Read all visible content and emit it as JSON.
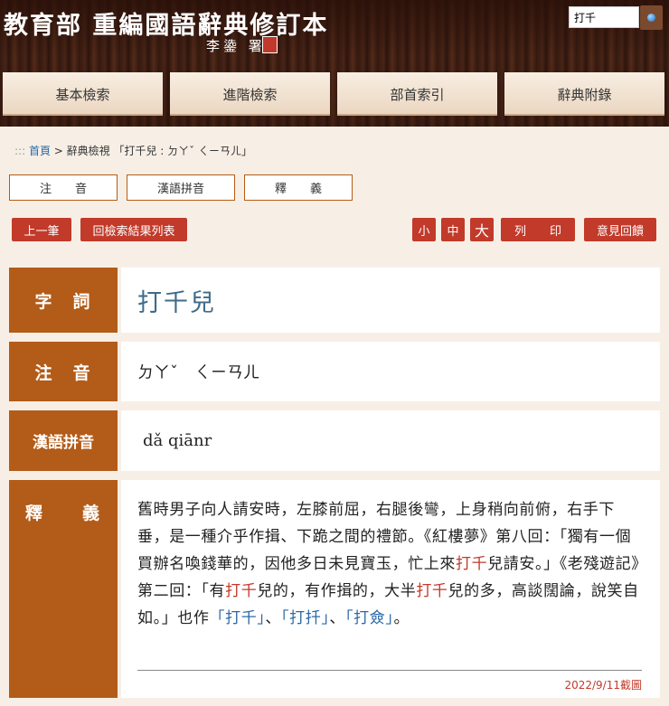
{
  "header": {
    "title": "教育部 重編國語辭典修訂本",
    "calligrapher": "李鍌 署",
    "search": {
      "value": "打千"
    }
  },
  "nav": [
    "基本檢索",
    "進階檢索",
    "部首索引",
    "辭典附錄"
  ],
  "breadcrumb": {
    "dots": ":::",
    "home": "首頁",
    "current": " > 辭典檢視 「打千兒 : ㄉㄚˇ ㄑㄧㄢㄦ」"
  },
  "view_tabs": [
    "注　　音",
    "漢語拼音",
    "釋　　義"
  ],
  "buttons": {
    "prev": "上一筆",
    "back": "回檢索結果列表",
    "small": "小",
    "medium": "中",
    "large": "大",
    "print": "列　　印",
    "feedback": "意見回饋"
  },
  "entry": {
    "labels": {
      "word": "字　詞",
      "zhuyin": "注　音",
      "pinyin": "漢語拼音",
      "definition": "釋　　義"
    },
    "word": "打千兒",
    "zhuyin": "ㄉㄚˇ　ㄑㄧㄢㄦ",
    "pinyin": "dǎ  qiānr",
    "definition": {
      "p1": "舊時男子向人請安時，左膝前屈，右腿後彎，上身稍向前俯，右手下垂，是一種介乎作揖、下跪之間的禮節。《紅樓夢》第八回：「獨有一個買辦名喚錢華的，因他多日未見寶玉，忙上來",
      "h1": "打千",
      "p2": "兒請安。」《老殘遊記》第二回：「有",
      "h2": "打千",
      "p3": "兒的，有作揖的，大半",
      "h3": "打千",
      "p4": "兒的多，高談闊論，說笑自如。」也作",
      "l1": "「打千」",
      "p5": "、",
      "l2": "「打扦」",
      "p6": "、",
      "l3": "「打僉」",
      "p7": "。"
    },
    "screenshot_date": "2022/9/11截圖"
  }
}
